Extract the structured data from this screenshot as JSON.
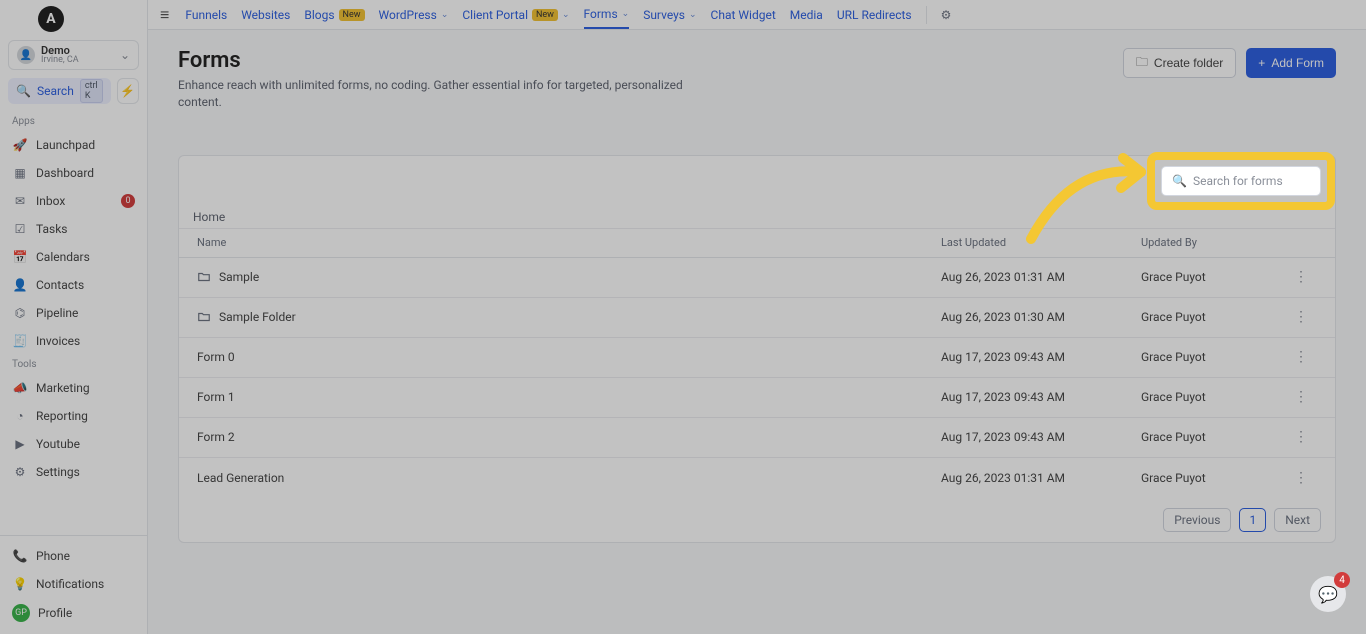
{
  "account": {
    "name": "Demo",
    "location": "Irvine, CA"
  },
  "search_sidebar": {
    "label": "Search",
    "shortcut": "ctrl K"
  },
  "section_labels": {
    "apps": "Apps",
    "tools": "Tools"
  },
  "sidebar": {
    "items": [
      {
        "label": "Launchpad",
        "icon": "🚀"
      },
      {
        "label": "Dashboard",
        "icon": "▦"
      },
      {
        "label": "Inbox",
        "icon": "✉",
        "badge": "0"
      },
      {
        "label": "Tasks",
        "icon": "☑"
      },
      {
        "label": "Calendars",
        "icon": "📅"
      },
      {
        "label": "Contacts",
        "icon": "👤"
      },
      {
        "label": "Pipeline",
        "icon": "⌬"
      },
      {
        "label": "Invoices",
        "icon": "🧾"
      }
    ],
    "tools": [
      {
        "label": "Marketing",
        "icon": "📣"
      },
      {
        "label": "Reporting",
        "icon": "◔"
      },
      {
        "label": "Youtube",
        "icon": "▶"
      },
      {
        "label": "Settings",
        "icon": "⚙"
      }
    ],
    "bottom": [
      {
        "label": "Phone",
        "icon": "📞"
      },
      {
        "label": "Notifications",
        "icon": "💡"
      },
      {
        "label": "Profile",
        "icon": "GP"
      }
    ]
  },
  "topnav": {
    "items": [
      {
        "label": "Funnels"
      },
      {
        "label": "Websites"
      },
      {
        "label": "Blogs",
        "new": true
      },
      {
        "label": "WordPress",
        "dropdown": true
      },
      {
        "label": "Client Portal",
        "new": true,
        "dropdown": true
      },
      {
        "label": "Forms",
        "dropdown": true,
        "active": true
      },
      {
        "label": "Surveys",
        "dropdown": true
      },
      {
        "label": "Chat Widget"
      },
      {
        "label": "Media"
      },
      {
        "label": "URL Redirects"
      }
    ]
  },
  "page": {
    "title": "Forms",
    "description": "Enhance reach with unlimited forms, no coding. Gather essential info for targeted, personalized content.",
    "create_folder": "Create folder",
    "add_form": "Add Form"
  },
  "table": {
    "home_crumb": "Home",
    "search_placeholder": "Search for forms",
    "headers": {
      "name": "Name",
      "updated": "Last Updated",
      "by": "Updated By"
    },
    "rows": [
      {
        "name": "Sample",
        "folder": true,
        "updated": "Aug 26, 2023 01:31 AM",
        "by": "Grace Puyot"
      },
      {
        "name": "Sample Folder",
        "folder": true,
        "updated": "Aug 26, 2023 01:30 AM",
        "by": "Grace Puyot"
      },
      {
        "name": "Form 0",
        "folder": false,
        "updated": "Aug 17, 2023 09:43 AM",
        "by": "Grace Puyot"
      },
      {
        "name": "Form 1",
        "folder": false,
        "updated": "Aug 17, 2023 09:43 AM",
        "by": "Grace Puyot"
      },
      {
        "name": "Form 2",
        "folder": false,
        "updated": "Aug 17, 2023 09:43 AM",
        "by": "Grace Puyot"
      },
      {
        "name": "Lead Generation",
        "folder": false,
        "updated": "Aug 26, 2023 01:31 AM",
        "by": "Grace Puyot"
      }
    ],
    "pager": {
      "prev": "Previous",
      "page": "1",
      "next": "Next"
    }
  },
  "chat": {
    "badge": "4"
  }
}
